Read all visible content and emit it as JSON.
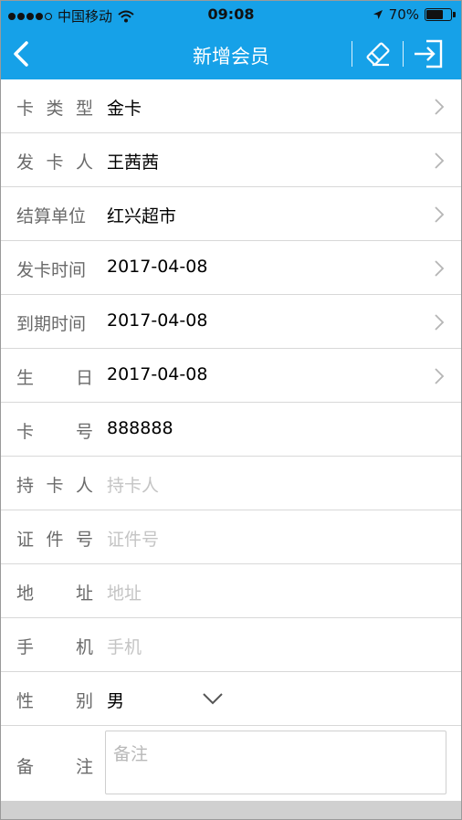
{
  "status_bar": {
    "carrier": "中国移动",
    "time": "09:08",
    "battery": "70%",
    "battery_level": 0.7,
    "icons": [
      "signal-dots-icon",
      "wifi-icon",
      "location-arrow-icon",
      "battery-icon"
    ]
  },
  "nav": {
    "title": "新增会员",
    "icons": [
      "back-chevron-icon",
      "eraser-icon",
      "sign-in-icon"
    ],
    "color": "#16a1e8"
  },
  "form": {
    "card_type": {
      "label": [
        "卡",
        "类",
        "型"
      ],
      "value": "金卡"
    },
    "issuer": {
      "label": [
        "发",
        "卡",
        "人"
      ],
      "value": "王茜茜"
    },
    "settlement_unit": {
      "label": [
        "结算单位"
      ],
      "value": "红兴超市"
    },
    "issue_time": {
      "label": [
        "发卡时间"
      ],
      "value": "2017-04-08"
    },
    "expiry_time": {
      "label": [
        "到期时间"
      ],
      "value": "2017-04-08"
    },
    "birthday": {
      "label": [
        "生",
        "日"
      ],
      "value": "2017-04-08"
    },
    "card_no": {
      "label": [
        "卡",
        "号"
      ],
      "value": "888888"
    },
    "holder": {
      "label": [
        "持",
        "卡",
        "人"
      ],
      "placeholder": "持卡人"
    },
    "id_no": {
      "label": [
        "证",
        "件",
        "号"
      ],
      "placeholder": "证件号"
    },
    "address": {
      "label": [
        "地",
        "址"
      ],
      "placeholder": "地址"
    },
    "mobile": {
      "label": [
        "手",
        "机"
      ],
      "placeholder": "手机"
    },
    "gender": {
      "label": [
        "性",
        "别"
      ],
      "value": "男"
    },
    "notes": {
      "label": [
        "备",
        "注"
      ],
      "placeholder": "备注"
    }
  }
}
